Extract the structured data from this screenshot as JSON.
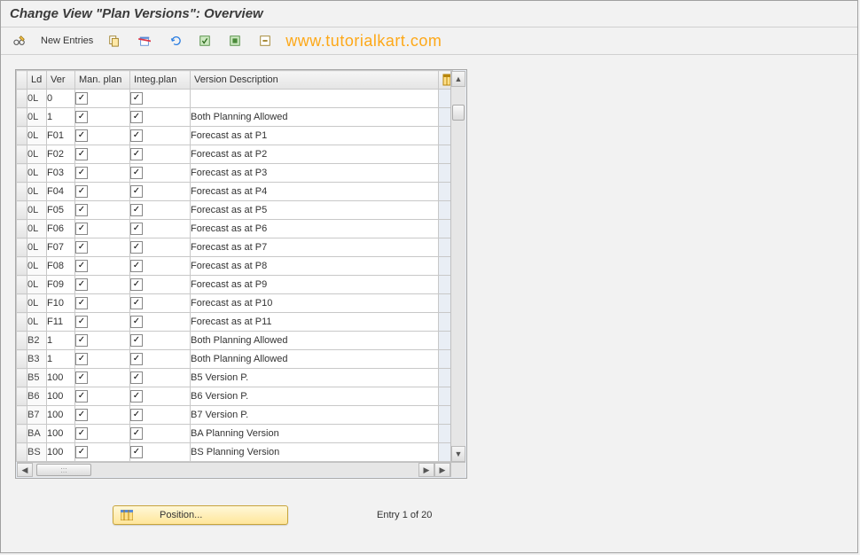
{
  "title": "Change View \"Plan Versions\": Overview",
  "watermark": "www.tutorialkart.com",
  "toolbar": {
    "new_entries_label": "New Entries"
  },
  "columns": {
    "ld": "Ld",
    "ver": "Ver",
    "man_plan": "Man. plan",
    "integ_plan": "Integ.plan",
    "desc": "Version Description"
  },
  "rows": [
    {
      "ld": "0L",
      "ver": "0",
      "man": true,
      "integ": true,
      "desc": ""
    },
    {
      "ld": "0L",
      "ver": "1",
      "man": true,
      "integ": true,
      "desc": "Both Planning Allowed"
    },
    {
      "ld": "0L",
      "ver": "F01",
      "man": true,
      "integ": true,
      "desc": "Forecast as at P1"
    },
    {
      "ld": "0L",
      "ver": "F02",
      "man": true,
      "integ": true,
      "desc": "Forecast as at P2"
    },
    {
      "ld": "0L",
      "ver": "F03",
      "man": true,
      "integ": true,
      "desc": "Forecast as at P3"
    },
    {
      "ld": "0L",
      "ver": "F04",
      "man": true,
      "integ": true,
      "desc": "Forecast as at P4"
    },
    {
      "ld": "0L",
      "ver": "F05",
      "man": true,
      "integ": true,
      "desc": "Forecast as at P5"
    },
    {
      "ld": "0L",
      "ver": "F06",
      "man": true,
      "integ": true,
      "desc": "Forecast as at P6"
    },
    {
      "ld": "0L",
      "ver": "F07",
      "man": true,
      "integ": true,
      "desc": "Forecast as at P7"
    },
    {
      "ld": "0L",
      "ver": "F08",
      "man": true,
      "integ": true,
      "desc": "Forecast as at P8"
    },
    {
      "ld": "0L",
      "ver": "F09",
      "man": true,
      "integ": true,
      "desc": "Forecast as at P9"
    },
    {
      "ld": "0L",
      "ver": "F10",
      "man": true,
      "integ": true,
      "desc": "Forecast as at P10"
    },
    {
      "ld": "0L",
      "ver": "F11",
      "man": true,
      "integ": true,
      "desc": "Forecast as at P11"
    },
    {
      "ld": "B2",
      "ver": "1",
      "man": true,
      "integ": true,
      "desc": "Both Planning Allowed"
    },
    {
      "ld": "B3",
      "ver": "1",
      "man": true,
      "integ": true,
      "desc": "Both Planning Allowed"
    },
    {
      "ld": "B5",
      "ver": "100",
      "man": true,
      "integ": true,
      "desc": "B5 Version P."
    },
    {
      "ld": "B6",
      "ver": "100",
      "man": true,
      "integ": true,
      "desc": "B6 Version P."
    },
    {
      "ld": "B7",
      "ver": "100",
      "man": true,
      "integ": true,
      "desc": "B7 Version P."
    },
    {
      "ld": "BA",
      "ver": "100",
      "man": true,
      "integ": true,
      "desc": "BA Planning Version"
    },
    {
      "ld": "BS",
      "ver": "100",
      "man": true,
      "integ": true,
      "desc": "BS Planning Version"
    }
  ],
  "footer": {
    "position_label": "Position...",
    "entry_status": "Entry 1 of 20"
  }
}
